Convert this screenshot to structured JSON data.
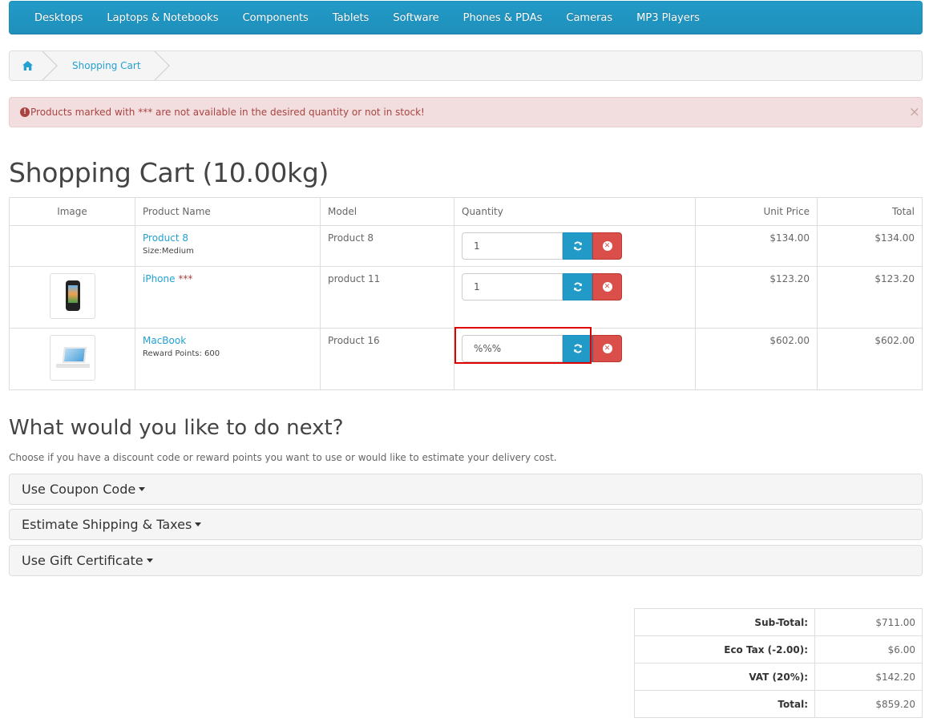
{
  "nav": {
    "items": [
      "Desktops",
      "Laptops & Notebooks",
      "Components",
      "Tablets",
      "Software",
      "Phones & PDAs",
      "Cameras",
      "MP3 Players"
    ]
  },
  "breadcrumb": {
    "current": "Shopping Cart",
    "home_icon": "home-icon"
  },
  "alert": {
    "icon": "exclamation-circle-icon",
    "text": "Products marked with *** are not available in the desired quantity or not in stock!",
    "close": "×"
  },
  "page": {
    "title": "Shopping Cart  (10.00kg)"
  },
  "cart": {
    "headers": {
      "image": "Image",
      "name": "Product Name",
      "model": "Model",
      "quantity": "Quantity",
      "unit_price": "Unit Price",
      "total": "Total"
    },
    "rows": [
      {
        "name": "Product 8",
        "stock_flag": "",
        "option": "Size:Medium",
        "model": "Product 8",
        "quantity": "1",
        "unit_price": "$134.00",
        "total": "$134.00",
        "image": "none"
      },
      {
        "name": "iPhone",
        "stock_flag": " ***",
        "option": "",
        "model": "product 11",
        "quantity": "1",
        "unit_price": "$123.20",
        "total": "$123.20",
        "image": "iphone-thumbnail"
      },
      {
        "name": "MacBook",
        "stock_flag": "",
        "option": "Reward Points: 600",
        "model": "Product 16",
        "quantity": "%%%",
        "unit_price": "$602.00",
        "total": "$602.00",
        "image": "macbook-thumbnail"
      }
    ],
    "refresh_icon": "refresh-icon",
    "remove_icon": "times-circle-icon"
  },
  "next": {
    "title": "What would you like to do next?",
    "description": "Choose if you have a discount code or reward points you want to use or would like to estimate your delivery cost.",
    "panels": [
      "Use Coupon Code",
      "Estimate Shipping & Taxes",
      "Use Gift Certificate"
    ]
  },
  "totals": [
    {
      "label": "Sub-Total:",
      "value": "$711.00"
    },
    {
      "label": "Eco Tax (-2.00):",
      "value": "$6.00"
    },
    {
      "label": "VAT (20%):",
      "value": "$142.20"
    },
    {
      "label": "Total:",
      "value": "$859.20"
    }
  ],
  "colors": {
    "primary": "#229ac8",
    "danger": "#da4f49",
    "alert_bg": "#f2dede",
    "alert_text": "#a94442",
    "link": "#23a1d1",
    "highlight": "#e00000"
  }
}
